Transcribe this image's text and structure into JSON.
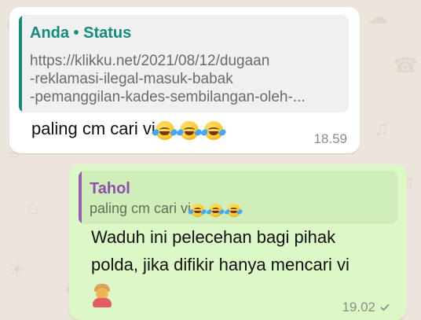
{
  "chat": {
    "messages": [
      {
        "direction": "incoming",
        "quote": {
          "author": "Anda • Status",
          "lines": [
            "https://klikku.net/2021/08/12/dugaan",
            "-reklamasi-ilegal-masuk-babak",
            "-pemanggilan-kades-sembilangan-oleh-..."
          ]
        },
        "text": "paling cm cari vi",
        "emoji_names": [
          "rolling-laughing-emoji",
          "rolling-laughing-emoji",
          "rolling-laughing-emoji"
        ],
        "time": "18.59"
      },
      {
        "direction": "outgoing",
        "quote": {
          "author": "Tahol",
          "text": "paling cm cari vi",
          "emoji_names": [
            "rolling-laughing-emoji",
            "rolling-laughing-emoji",
            "rolling-laughing-emoji"
          ]
        },
        "lines": [
          "Waduh ini pelecehan bagi pihak",
          "polda, jika difikir hanya mencari vi"
        ],
        "trailing_icon": "facepalm-emoji",
        "time": "19.02",
        "status_icon": "single-check-icon"
      }
    ]
  },
  "colors": {
    "background": "#ece5dd",
    "incoming_bubble": "#ffffff",
    "outgoing_bubble": "#dcf8c6",
    "status_quote_author": "#128c7e",
    "reply_quote_author": "#8e4fab",
    "timestamp": "#8c8c8c"
  }
}
